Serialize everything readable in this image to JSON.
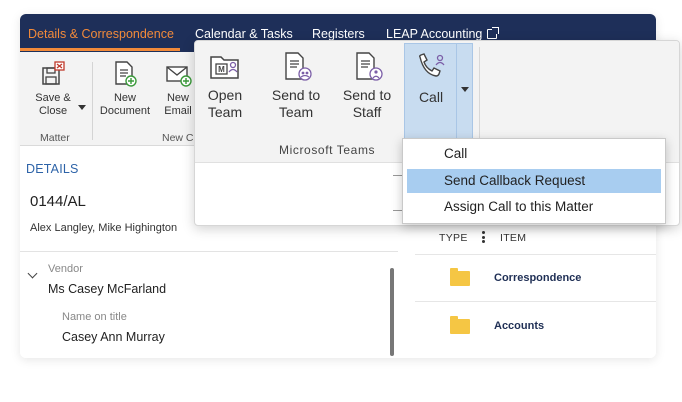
{
  "tabs": [
    {
      "label": "Details & Correspondence",
      "active": true
    },
    {
      "label": "Calendar & Tasks",
      "active": false
    },
    {
      "label": "Registers",
      "active": false
    },
    {
      "label": "LEAP Accounting",
      "active": false
    }
  ],
  "ribbon": {
    "save_close": {
      "line1": "Save &",
      "line2": "Close"
    },
    "matter_group": "Matter",
    "new_document": {
      "line1": "New",
      "line2": "Document"
    },
    "new_email": {
      "line1": "New",
      "line2": "Email"
    },
    "new_comms_group": "New Co"
  },
  "details": {
    "title": "DETAILS",
    "matter_number": "0144/AL",
    "staff_names": "Alex Langley, Mike Highington",
    "vendor_label": "Vendor",
    "vendor_value": "Ms Casey McFarland",
    "name_on_title_label": "Name on title",
    "name_on_title_value": "Casey Ann Murray"
  },
  "documents": {
    "col_type": "TYPE",
    "col_item": "ITEM",
    "items": [
      {
        "name": "Correspondence",
        "icon": "folder-icon"
      },
      {
        "name": "Accounts",
        "icon": "folder-icon"
      }
    ]
  },
  "teams": {
    "open_team": {
      "line1": "Open",
      "line2": "Team"
    },
    "send_to_team": {
      "line1": "Send to",
      "line2": "Team"
    },
    "send_to_staff": {
      "line1": "Send to",
      "line2": "Staff"
    },
    "call": "Call",
    "group_label": "Microsoft  Teams"
  },
  "call_menu": {
    "items": [
      {
        "label": "Call",
        "highlighted": false
      },
      {
        "label": "Send Callback Request",
        "highlighted": true
      },
      {
        "label": "Assign Call to this Matter",
        "highlighted": false
      }
    ]
  },
  "colors": {
    "tabbar_bg": "#1e2f59",
    "active_tab": "#f28a3a",
    "details_title": "#2d63a8",
    "menu_highlight": "#a8cdf0",
    "teams_accent": "#7b5ea7",
    "folder": "#f5c644"
  }
}
